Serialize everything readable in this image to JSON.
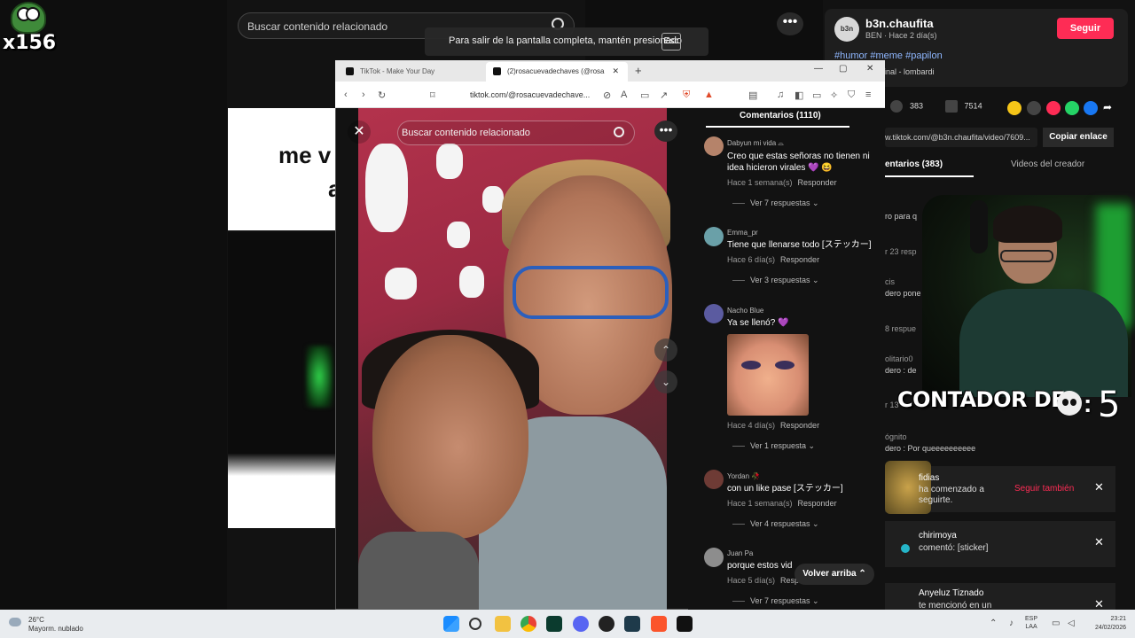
{
  "overlay": {
    "frog_counter": "x156",
    "counter_label": "CONTADOR DE",
    "counter_value": "5"
  },
  "background_page": {
    "search_text": "Buscar contenido relacionado",
    "video_text": "me v",
    "video_text2": "a"
  },
  "fullscreen_notice": {
    "text": "Para salir de la pantalla completa, mantén presionado",
    "key": "Esc"
  },
  "browser": {
    "tabs": [
      {
        "label": "TikTok - Make Your Day"
      },
      {
        "label": "(2)rosacuevadechaves (@rosa"
      }
    ],
    "new_tab": "+",
    "url": "tiktok.com/@rosacuevadechave..."
  },
  "video_page": {
    "search_placeholder": "Buscar contenido relacionado",
    "close": "✕",
    "more": "•••",
    "nav_up": "⌃",
    "nav_down": "⌄"
  },
  "comments": {
    "title": "Comentarios (1110)",
    "items": [
      {
        "name": "Dabyun mi vida ⌓",
        "text": "Creo que estas señoras no tienen ni idea hicieron virales 💜 😆",
        "time": "Hace 1 semana(s)",
        "reply": "Responder",
        "more": "Ver 7 respuestas ⌄",
        "avatar_color": "#b5836a"
      },
      {
        "name": "Emma_pr",
        "text": "Tiene que llenarse todo [ステッカー]",
        "time": "Hace 6 día(s)",
        "reply": "Responder",
        "more": "Ver 3 respuestas ⌄",
        "avatar_color": "#6aa0a8"
      },
      {
        "name": "Nacho Blue",
        "text": "Ya se llenó? 💜",
        "time": "Hace 4 día(s)",
        "reply": "Responder",
        "more": "Ver 1 respuesta ⌄",
        "avatar_color": "#5b5ba0"
      },
      {
        "name": "Yordan 🥀",
        "text": "con un like pase [ステッカー]",
        "time": "Hace 1 semana(s)",
        "reply": "Responder",
        "more": "Ver 4 respuestas ⌄",
        "avatar_color": "#6e3b35"
      },
      {
        "name": "Juan Pa",
        "text": "porque estos vid",
        "time": "Hace 5 día(s)",
        "reply": "Resp",
        "more": "Ver 7 respuestas ⌄",
        "avatar_color": "#8d8d8d"
      }
    ],
    "back_to_top": "Volver arriba ⌃"
  },
  "profile_panel": {
    "avatar_text": "b3n",
    "username": "b3n.chaufita",
    "sub": "BEN · Hace 2 día(s)",
    "follow": "Seguir",
    "tags": "#humor #meme #papilon",
    "sound": "ginal - lombardi",
    "comments_count": "383",
    "saves_count": "7514",
    "link": "w.tiktok.com/@b3n.chaufita/video/7609...",
    "copy_link": "Copiar enlace",
    "tab_comments": "entarios (383)",
    "tab_creator": "Videos del creador",
    "fragments": [
      "ro para q",
      "r 23 resp",
      "cis",
      "dero pone",
      "8 respue",
      "olitario0",
      "dero : de",
      "r 13",
      "ógnito",
      "dero : Por queeeeeeeeee"
    ]
  },
  "notifications": [
    {
      "name": "fidias",
      "text": "ha comenzado a seguirte.",
      "action": "Seguir también"
    },
    {
      "name": "chirimoya",
      "text": "comentó: [sticker]",
      "action": ""
    },
    {
      "name": "Anyeluz Tiznado",
      "text": "te mencionó en un",
      "action": ""
    }
  ],
  "taskbar": {
    "temp": "26°C",
    "weather": "Mayorm. nublado",
    "lang1": "ESP",
    "lang2": "LAA",
    "time": "23:21",
    "date": "24/02/2026"
  }
}
